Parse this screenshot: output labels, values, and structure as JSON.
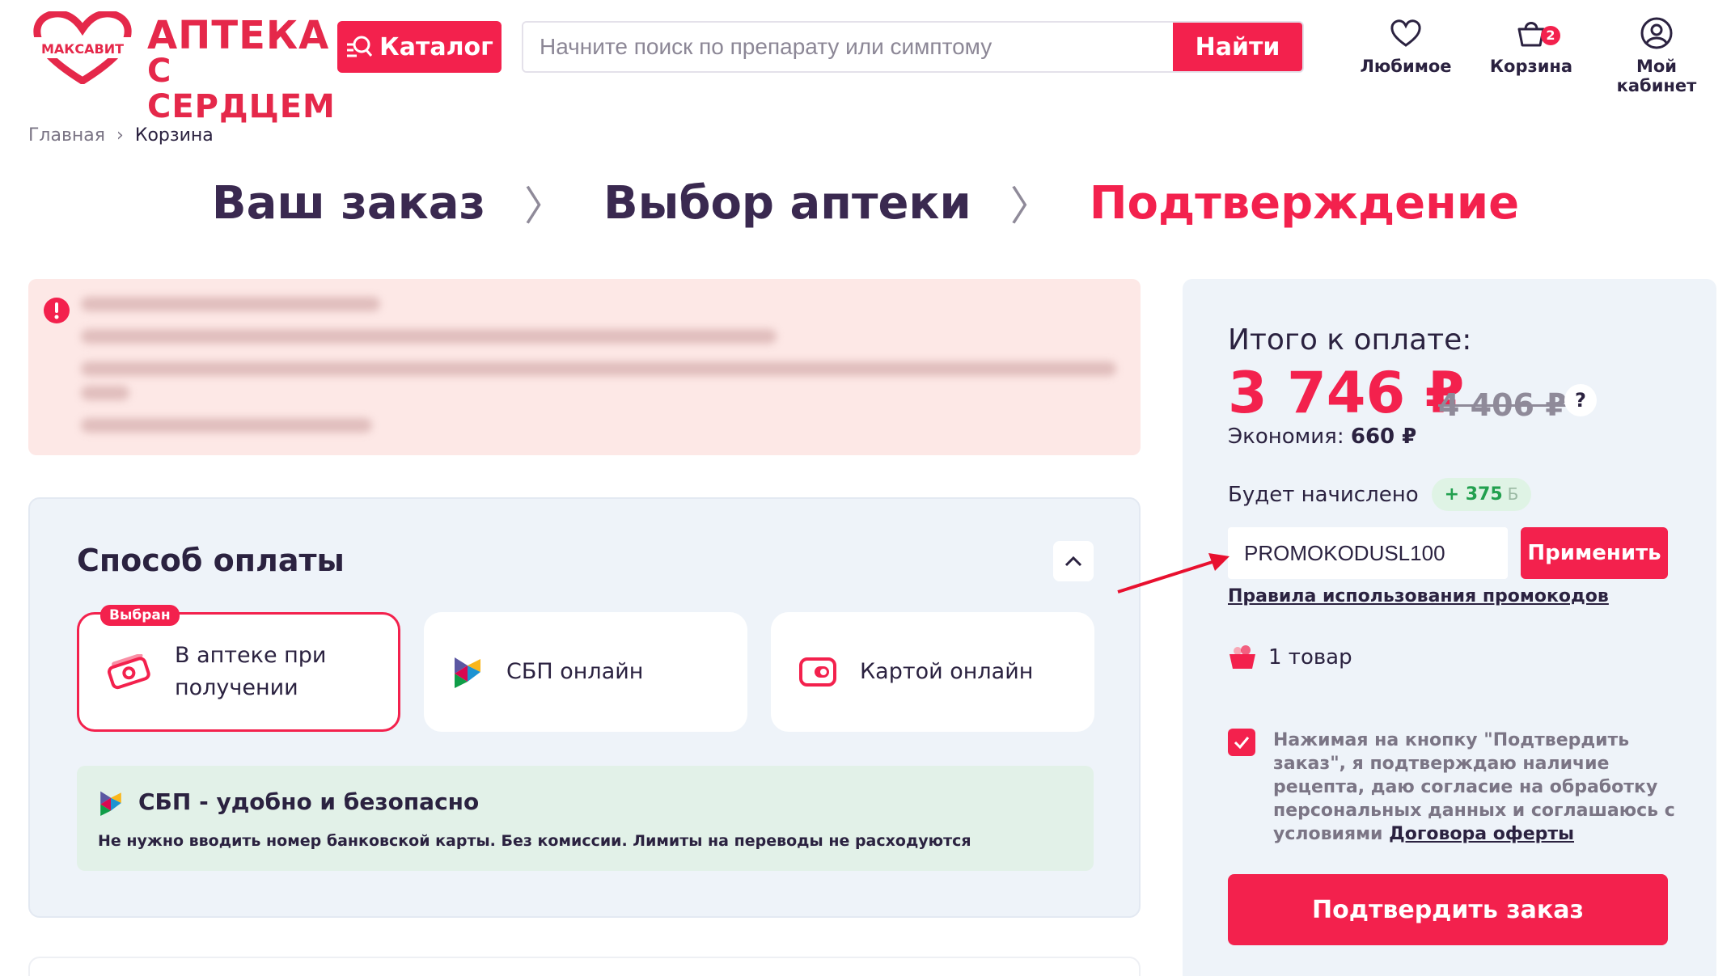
{
  "brand": {
    "logo_small": "МАКСАВИТ",
    "logo_line1": "АПТЕКА",
    "logo_line2": "С СЕРДЦЕМ",
    "accent": "#f3214d"
  },
  "header": {
    "catalog_label": "Каталог",
    "search_placeholder": "Начните поиск по препарату или симптому",
    "search_value": "",
    "find_label": "Найти",
    "favorites_label": "Любимое",
    "cart_label": "Корзина",
    "cart_count": "2",
    "account_label": "Мой кабинет"
  },
  "breadcrumb": {
    "home": "Главная",
    "current": "Корзина"
  },
  "steps": [
    {
      "label": "Ваш заказ",
      "state": "done"
    },
    {
      "label": "Выбор аптеки",
      "state": "done"
    },
    {
      "label": "Подтверждение",
      "state": "active"
    }
  ],
  "payment": {
    "title": "Способ оплаты",
    "options": [
      {
        "label": "В аптеке при получении",
        "line1": "В аптеке при",
        "line2": "получении",
        "badge": "Выбран",
        "icon": "cash-icon",
        "selected": true
      },
      {
        "label": "СБП онлайн",
        "icon": "sbp-icon",
        "selected": false
      },
      {
        "label": "Картой онлайн",
        "icon": "card-icon",
        "selected": false
      }
    ],
    "sbp_note_title": "СБП - удобно и безопасно",
    "sbp_note_text": "Не нужно вводить номер банковской карты. Без комиссии. Лимиты на переводы не расходуются"
  },
  "summary": {
    "title": "Итого к оплате:",
    "price": "3 746 ₽",
    "old_price": "4 406 ₽",
    "help": "?",
    "economy_label": "Экономия:",
    "economy_value": "660 ₽",
    "bonus_label": "Будет начислено",
    "bonus_value": "+ 375",
    "bonus_icon": "Б",
    "promo_value": "PROMOKODUSL100",
    "apply_label": "Применить",
    "promo_rules": "Правила использования промокодов",
    "items_count": "1 товар",
    "consent_checked": true,
    "consent_text": "Нажимая на кнопку \"Подтвердить заказ\", я подтверждаю наличие рецепта, даю согласие на обработку персональных данных и соглашаюсь с условиями",
    "consent_link": "Договора оферты",
    "confirm_label": "Подтвердить заказ"
  }
}
